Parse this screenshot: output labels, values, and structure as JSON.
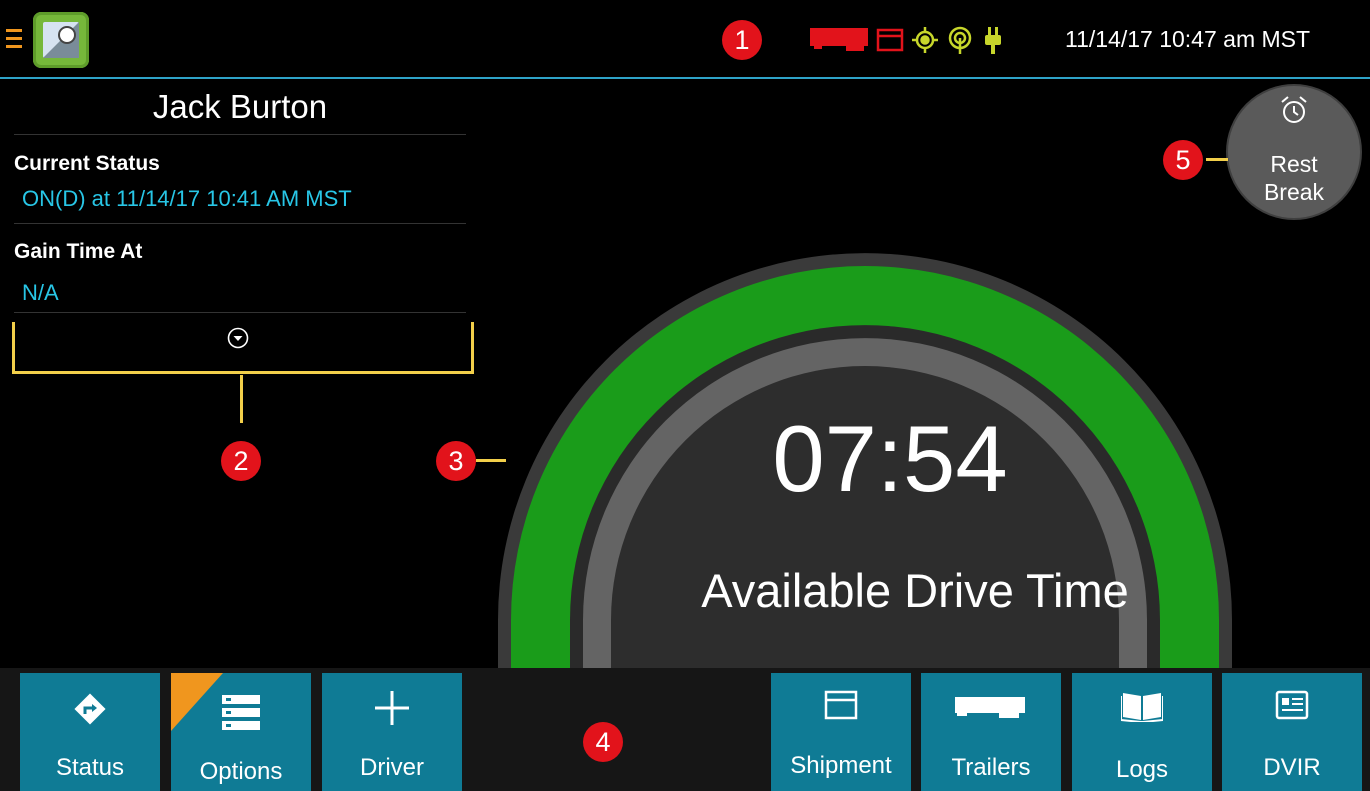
{
  "header": {
    "datetime": "11/14/17 10:47 am MST",
    "status_icons": [
      "trailer-icon",
      "shipment-icon",
      "gps-icon",
      "cellular-icon",
      "power-plug-icon"
    ],
    "accent_color": "#2ea3c8"
  },
  "callouts": [
    "1",
    "2",
    "3",
    "4",
    "5"
  ],
  "driver": {
    "name": "Jack Burton",
    "current_status_label": "Current Status",
    "current_status_value": "ON(D) at 11/14/17 10:41 AM MST",
    "gain_time_label": "Gain Time At",
    "gain_time_value": "N/A"
  },
  "gauge": {
    "time": "07:54",
    "label": "Available Drive Time",
    "fill_fraction": 1.0,
    "fill_color": "#1a9c1a"
  },
  "rest_break": {
    "line1": "Rest",
    "line2": "Break",
    "icon": "alarm-clock-icon"
  },
  "nav": {
    "status": "Status",
    "options": "Options",
    "driver": "Driver",
    "shipment": "Shipment",
    "trailers": "Trailers",
    "logs": "Logs",
    "dvir": "DVIR"
  }
}
